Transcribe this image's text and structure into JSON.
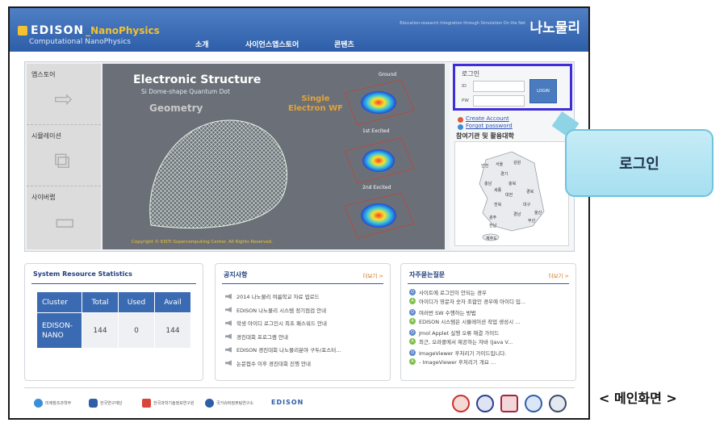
{
  "header": {
    "logo_text": "EDISON",
    "logo_suffix": "_NanoPhysics",
    "logo_sub": "Computational NanoPhysics",
    "menu": [
      "소개",
      "사이언스앱스토어",
      "콘텐츠"
    ],
    "tagline": "Education-research Integration through Simulation On the Net",
    "brand": "나노물리"
  },
  "sidebar": {
    "items": [
      {
        "label": "앱스토어"
      },
      {
        "label": "시뮬레이션"
      },
      {
        "label": "사이버랩"
      }
    ]
  },
  "visual": {
    "title": "Electronic Structure",
    "subtitle": "Si Dome-shape Quantum Dot",
    "geometry": "Geometry",
    "single_l1": "Single",
    "single_l2": "Electron WF",
    "wf_labels": [
      "Ground",
      "1st Excited",
      "2nd Excited"
    ],
    "copyright": "Copyright © KISTI Supercomputing Center. All Rights Reserved."
  },
  "login": {
    "title": "로그인",
    "id_label": "ID",
    "pw_label": "PW",
    "button": "LOGIN",
    "create_account": "Create Account",
    "forgot_password": "Forgot password",
    "partners_title": "참여기관 및 활용대학",
    "map_labels": [
      "강원",
      "인천",
      "서울",
      "경기",
      "충남",
      "충북",
      "세종",
      "경북",
      "대전",
      "전북",
      "대구",
      "울산",
      "경남",
      "광주",
      "부산",
      "전남",
      "제주도"
    ]
  },
  "stats": {
    "title": "System Resource Statistics",
    "headers": [
      "Cluster",
      "Total",
      "Used",
      "Avail"
    ],
    "rows": [
      [
        "EDISON-NANO",
        "144",
        "0",
        "144"
      ]
    ]
  },
  "notices": {
    "title": "공지사항",
    "more": "더보기 >",
    "items": [
      "2014 나노물리 여름학교 자료 업로드",
      "EDISON 나노물리 시스템 정기점검 안내",
      "학생 아이디 로그인시 최초 패스워드 안내",
      "경진대회 프로그램 안내",
      "EDISON 경진대회 나노물리분야 구두/포스터...",
      "논문접수 이후 경진대회 진행 안내"
    ]
  },
  "faq": {
    "title": "자주묻는질문",
    "more": "더보기 >",
    "items": [
      {
        "q": "사이트에 로그인이 안되는 경우",
        "a": "아이디가 영문자 숫자 조합인 경우에 아이디 입..."
      },
      {
        "q": "여러번 SW 수행하는 방법",
        "a": "EDISON 시스템은 시뮬레이션 작업 생성시 ..."
      },
      {
        "q": "Jmol Applet 실행 오류 해결 가이드",
        "a": "최근, 오라클에서 제공하는 자바 (Java V..."
      },
      {
        "q": "ImageViewer 후처리기 가이드입니다.",
        "a": "- ImageViewer 후처리기 개요 ..."
      }
    ]
  },
  "footer": {
    "logos": [
      "미래창조과학부",
      "한국연구재단",
      "한국과학기술정보연구원",
      "국가슈퍼컴퓨팅연구소",
      "EDISON"
    ]
  },
  "callout": {
    "text": "로그인"
  },
  "caption": "< 메인화면 >",
  "colors": {
    "header": "#2e5ea8",
    "highlight": "#3f2dd8",
    "callout": "#a6dff0",
    "more_link": "#d07a1a"
  }
}
